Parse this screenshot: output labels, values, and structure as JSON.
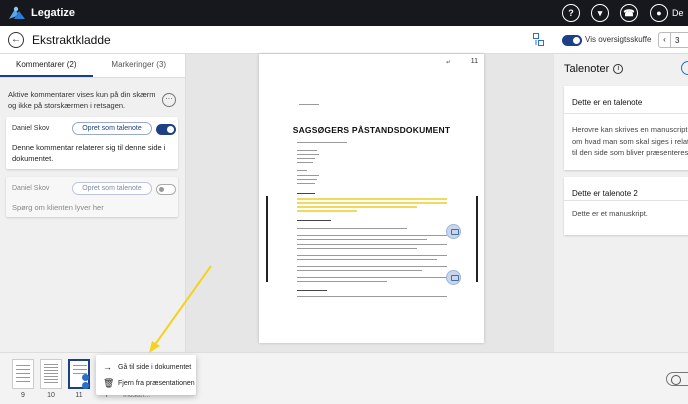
{
  "app": {
    "name": "Legatize"
  },
  "topbar": {
    "icons": [
      "help-icon",
      "shield-icon",
      "phone-icon",
      "user-icon"
    ],
    "user_initials": "De"
  },
  "header": {
    "title": "Ekstraktkladde",
    "overview_label": "Vis oversigtsskuffe",
    "overview_on": true,
    "page_prefix": "3"
  },
  "left": {
    "tabs": [
      {
        "label": "Kommentarer (2)",
        "active": true
      },
      {
        "label": "Markeringer (3)",
        "active": false
      }
    ],
    "info": "Aktive kommentarer vises kun på din skærm og ikke på storskærmen i retsagen.",
    "comments": [
      {
        "author": "Daniel Skov",
        "button": "Opret som talenote",
        "active": true,
        "text": "Denne kommentar relaterer sig til denne side i dokumentet."
      },
      {
        "author": "Daniel Skov",
        "button": "Opret som talenote",
        "active": false,
        "text": "Spørg om klienten lyver her"
      }
    ]
  },
  "document": {
    "page_number": "11",
    "heading": "SAGSØGERS PÅSTANDSDOKUMENT"
  },
  "right": {
    "title": "Talenoter",
    "notes": [
      {
        "title": "Dette er en talenote",
        "body": "Herovre kan skrives en manuscript, om hvad man som skal siges i relation til den side som bliver præsenteres."
      },
      {
        "title": "Dette er talenote 2",
        "body": "Dette er et manuskript."
      }
    ]
  },
  "bottom": {
    "thumbs": [
      {
        "label": "9"
      },
      {
        "label": "10"
      },
      {
        "label": "11"
      },
      {
        "label": "7"
      }
    ],
    "behind_text": "Indsæt...",
    "menu": [
      {
        "icon": "arrow-right-icon",
        "label": "Gå til side i dokumentet"
      },
      {
        "icon": "trash-icon",
        "label": "Fjern fra præsentationen"
      }
    ]
  },
  "colors": {
    "accent": "#1c3f86",
    "highlight": "#f0d95c",
    "arrow": "#f4d21f",
    "topbar": "#16181d"
  }
}
